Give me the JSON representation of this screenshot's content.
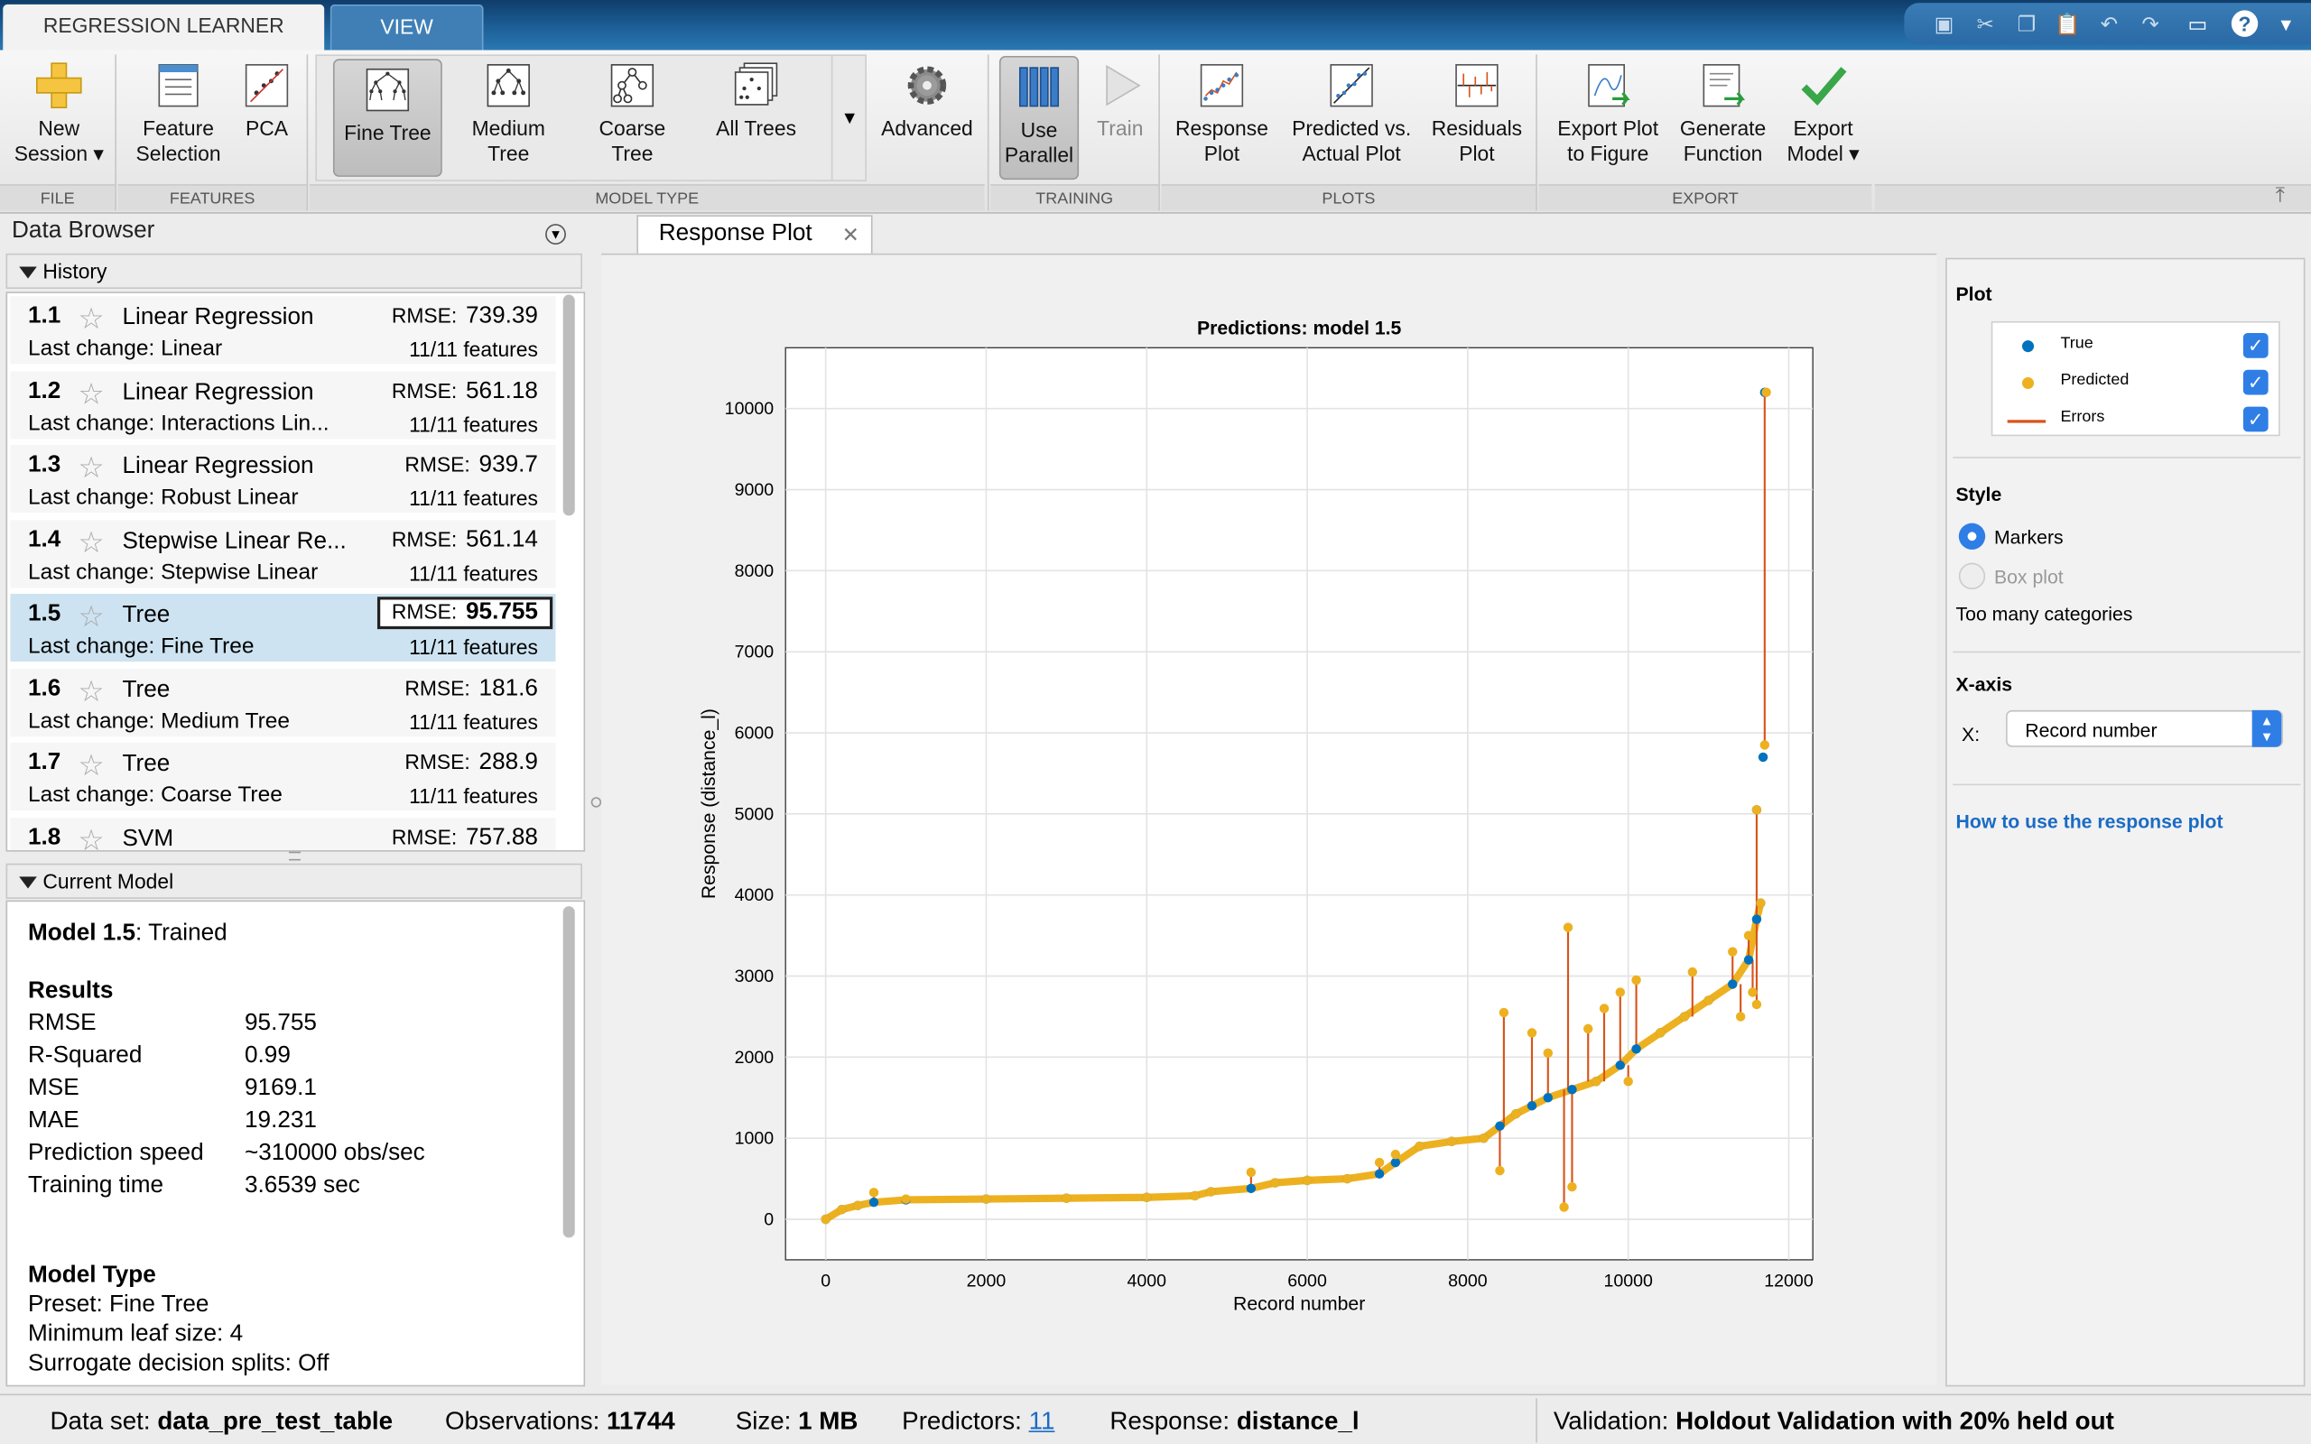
{
  "tabs": {
    "regression": "REGRESSION LEARNER",
    "view": "VIEW"
  },
  "ribbon": {
    "file": {
      "new_session": "New\nSession ▾",
      "group": "FILE"
    },
    "features": {
      "feature_selection": "Feature\nSelection",
      "pca": "PCA",
      "group": "FEATURES"
    },
    "model_type": {
      "fine_tree": "Fine Tree",
      "medium_tree": "Medium\nTree",
      "coarse_tree": "Coarse\nTree",
      "all_trees": "All Trees",
      "advanced": "Advanced",
      "group": "MODEL TYPE"
    },
    "training": {
      "use_parallel": "Use\nParallel",
      "train": "Train",
      "group": "TRAINING"
    },
    "plots": {
      "response_plot": "Response\nPlot",
      "predicted_actual": "Predicted vs.\nActual Plot",
      "residuals": "Residuals\nPlot",
      "group": "PLOTS"
    },
    "export": {
      "export_plot": "Export Plot\nto Figure",
      "generate_function": "Generate\nFunction",
      "export_model": "Export\nModel ▾",
      "group": "EXPORT"
    }
  },
  "data_browser": {
    "title": "Data Browser",
    "history_label": "History",
    "history": [
      {
        "num": "1.1",
        "name": "Linear Regression",
        "rmse_label": "RMSE:",
        "rmse": "739.39",
        "last_change_label": "Last change:",
        "last_change": "Linear",
        "features": "11/11 features"
      },
      {
        "num": "1.2",
        "name": "Linear Regression",
        "rmse_label": "RMSE:",
        "rmse": "561.18",
        "last_change_label": "Last change:",
        "last_change": "Interactions Lin...",
        "features": "11/11 features"
      },
      {
        "num": "1.3",
        "name": "Linear Regression",
        "rmse_label": "RMSE:",
        "rmse": "939.7",
        "last_change_label": "Last change:",
        "last_change": "Robust Linear",
        "features": "11/11 features"
      },
      {
        "num": "1.4",
        "name": "Stepwise Linear Re...",
        "rmse_label": "RMSE:",
        "rmse": "561.14",
        "last_change_label": "Last change:",
        "last_change": "Stepwise Linear",
        "features": "11/11 features"
      },
      {
        "num": "1.5",
        "name": "Tree",
        "rmse_label": "RMSE:",
        "rmse": "95.755",
        "last_change_label": "Last change:",
        "last_change": "Fine Tree",
        "features": "11/11 features"
      },
      {
        "num": "1.6",
        "name": "Tree",
        "rmse_label": "RMSE:",
        "rmse": "181.6",
        "last_change_label": "Last change:",
        "last_change": "Medium Tree",
        "features": "11/11 features"
      },
      {
        "num": "1.7",
        "name": "Tree",
        "rmse_label": "RMSE:",
        "rmse": "288.9",
        "last_change_label": "Last change:",
        "last_change": "Coarse Tree",
        "features": "11/11 features"
      },
      {
        "num": "1.8",
        "name": "SVM",
        "rmse_label": "RMSE:",
        "rmse": "757.88",
        "last_change_label": "",
        "last_change": "",
        "features": ""
      }
    ],
    "current_model_label": "Current Model",
    "current_model": {
      "title": "Model 1.5",
      "status": ": Trained",
      "results_label": "Results",
      "results": [
        {
          "k": "RMSE",
          "v": "95.755"
        },
        {
          "k": "R-Squared",
          "v": "0.99"
        },
        {
          "k": "MSE",
          "v": "9169.1"
        },
        {
          "k": "MAE",
          "v": "19.231"
        },
        {
          "k": "Prediction speed",
          "v": "~310000 obs/sec"
        },
        {
          "k": "Training time",
          "v": "3.6539 sec"
        }
      ],
      "model_type_label": "Model Type",
      "preset": "Preset: Fine Tree",
      "min_leaf": "Minimum leaf size: 4",
      "surrogate": "Surrogate decision splits: Off"
    }
  },
  "document_tab": "Response Plot",
  "chart_data": {
    "type": "scatter",
    "title": "Predictions: model 1.5",
    "xlabel": "Record number",
    "ylabel": "Response (distance_l)",
    "xlim": [
      -500,
      12300
    ],
    "ylim": [
      -500,
      10750
    ],
    "xticks": [
      0,
      2000,
      4000,
      6000,
      8000,
      10000,
      12000
    ],
    "yticks": [
      0,
      1000,
      2000,
      3000,
      4000,
      5000,
      6000,
      7000,
      8000,
      9000,
      10000
    ],
    "grid": true,
    "series": [
      {
        "name": "True",
        "color": "#0072bd",
        "points": [
          [
            0,
            0
          ],
          [
            200,
            120
          ],
          [
            400,
            170
          ],
          [
            600,
            210
          ],
          [
            1000,
            240
          ],
          [
            2000,
            250
          ],
          [
            3000,
            260
          ],
          [
            4000,
            270
          ],
          [
            4600,
            290
          ],
          [
            4800,
            340
          ],
          [
            5300,
            380
          ],
          [
            5600,
            450
          ],
          [
            6000,
            480
          ],
          [
            6500,
            500
          ],
          [
            6900,
            560
          ],
          [
            7100,
            700
          ],
          [
            7400,
            900
          ],
          [
            7800,
            960
          ],
          [
            8200,
            1000
          ],
          [
            8400,
            1150
          ],
          [
            8600,
            1300
          ],
          [
            8800,
            1400
          ],
          [
            9000,
            1500
          ],
          [
            9300,
            1600
          ],
          [
            9600,
            1700
          ],
          [
            9900,
            1900
          ],
          [
            10100,
            2100
          ],
          [
            10400,
            2300
          ],
          [
            10700,
            2500
          ],
          [
            11000,
            2700
          ],
          [
            11300,
            2900
          ],
          [
            11500,
            3200
          ],
          [
            11600,
            3700
          ],
          [
            11650,
            3900
          ],
          [
            11600,
            5050
          ],
          [
            11680,
            5700
          ],
          [
            11700,
            10200
          ]
        ]
      },
      {
        "name": "Predicted",
        "color": "#edb120",
        "points": [
          [
            0,
            0
          ],
          [
            200,
            120
          ],
          [
            400,
            170
          ],
          [
            600,
            330
          ],
          [
            1000,
            250
          ],
          [
            2000,
            250
          ],
          [
            3000,
            260
          ],
          [
            4000,
            270
          ],
          [
            4600,
            290
          ],
          [
            4800,
            340
          ],
          [
            5300,
            580
          ],
          [
            5600,
            450
          ],
          [
            6000,
            480
          ],
          [
            6500,
            500
          ],
          [
            6900,
            700
          ],
          [
            7100,
            800
          ],
          [
            7400,
            900
          ],
          [
            7800,
            960
          ],
          [
            8200,
            1000
          ],
          [
            8400,
            600
          ],
          [
            8450,
            2550
          ],
          [
            8600,
            1300
          ],
          [
            8800,
            2300
          ],
          [
            9000,
            2050
          ],
          [
            9200,
            150
          ],
          [
            9250,
            3600
          ],
          [
            9300,
            400
          ],
          [
            9500,
            2350
          ],
          [
            9600,
            1700
          ],
          [
            9700,
            2600
          ],
          [
            9900,
            2800
          ],
          [
            10000,
            1700
          ],
          [
            10100,
            2950
          ],
          [
            10400,
            2300
          ],
          [
            10700,
            2500
          ],
          [
            10800,
            3050
          ],
          [
            11000,
            2700
          ],
          [
            11300,
            3300
          ],
          [
            11400,
            2500
          ],
          [
            11500,
            3500
          ],
          [
            11550,
            2800
          ],
          [
            11600,
            2650
          ],
          [
            11650,
            3900
          ],
          [
            11600,
            5050
          ],
          [
            11700,
            5850
          ],
          [
            11720,
            10200
          ]
        ]
      }
    ],
    "errors_label": "Errors",
    "error_color": "#d95319"
  },
  "right_panel": {
    "plot_label": "Plot",
    "legend": [
      {
        "label": "True",
        "color": "#0072bd",
        "type": "dot",
        "checked": true
      },
      {
        "label": "Predicted",
        "color": "#edb120",
        "type": "dot",
        "checked": true
      },
      {
        "label": "Errors",
        "color": "#d95319",
        "type": "line",
        "checked": true
      }
    ],
    "style_label": "Style",
    "markers": "Markers",
    "box_plot": "Box plot",
    "too_many": "Too many categories",
    "xaxis_label": "X-axis",
    "x_prefix": "X:",
    "x_value": "Record number",
    "help_link": "How to use the response plot"
  },
  "status": {
    "dataset_label": "Data set:",
    "dataset": "data_pre_test_table",
    "obs_label": "Observations:",
    "obs": "11744",
    "size_label": "Size:",
    "size": "1 MB",
    "pred_label": "Predictors:",
    "pred": "11",
    "resp_label": "Response:",
    "resp": "distance_l",
    "val_label": "Validation:",
    "val": "Holdout Validation with 20% held out"
  }
}
